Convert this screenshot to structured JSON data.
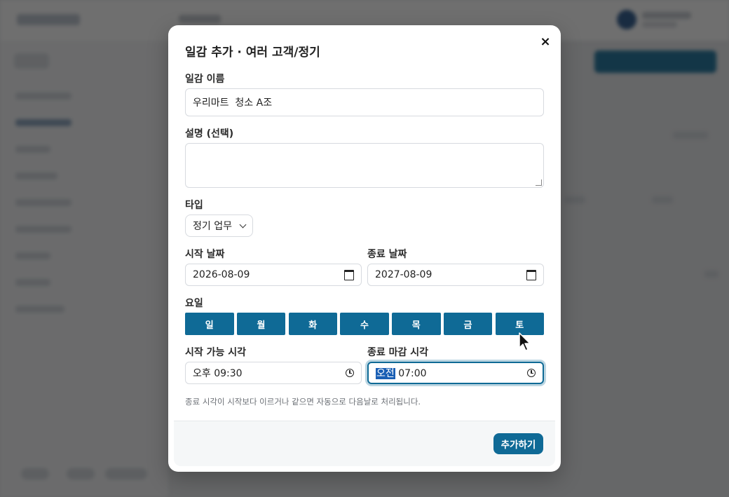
{
  "modal": {
    "title": "일감 추가 · 여러 고객/정기",
    "close_glyph": "×",
    "name_label": "일감 이름",
    "name_value": "우리마트  청소 A조",
    "description_label": "설명 (선택)",
    "description_value": "",
    "type_label": "타입",
    "type_value": "정기 업무",
    "start_date_label": "시작 날짜",
    "start_date_value": "2026-08-09",
    "end_date_label": "종료 날짜",
    "end_date_value": "2027-08-09",
    "weekday_label": "요일",
    "weekdays": [
      "일",
      "월",
      "화",
      "수",
      "목",
      "금",
      "토"
    ],
    "start_time_label": "시작 가능 시각",
    "start_time_ampm": "오후",
    "start_time_value": "09:30",
    "end_time_label": "종료 마감 시각",
    "end_time_ampm": "오전",
    "end_time_value": "07:00",
    "hint": "종료 시각이 시작보다 이르거나 같으면 자동으로 다음날로 처리됩니다.",
    "submit_label": "추가하기"
  },
  "colors": {
    "accent": "#0f6a96",
    "overlay": "#161616"
  }
}
